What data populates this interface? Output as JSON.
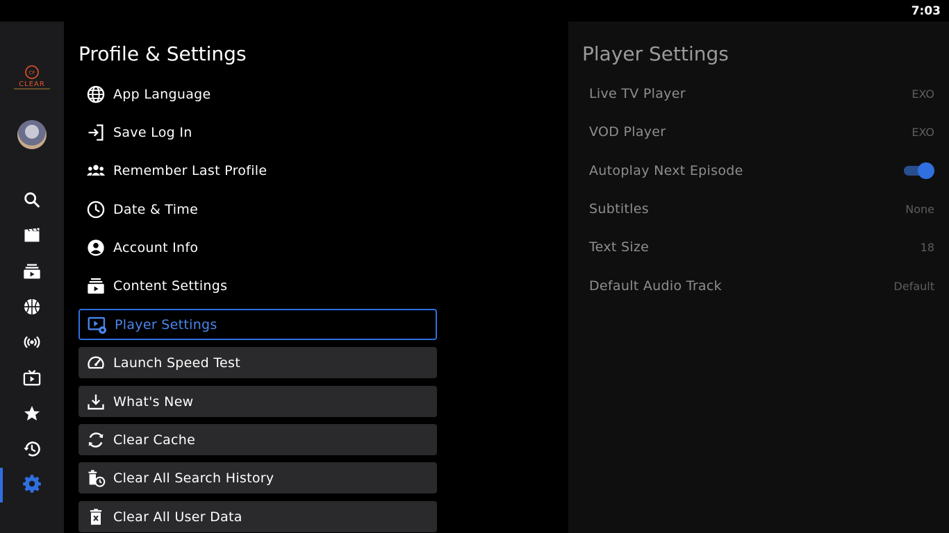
{
  "status": {
    "time": "7:03"
  },
  "nav": {
    "logo_text": "CLEAR",
    "items": [
      {
        "name": "search-icon"
      },
      {
        "name": "movies-icon"
      },
      {
        "name": "series-icon"
      },
      {
        "name": "sports-icon"
      },
      {
        "name": "broadcast-icon"
      },
      {
        "name": "live-tv-icon"
      },
      {
        "name": "favorites-icon"
      },
      {
        "name": "history-icon"
      },
      {
        "name": "settings-icon",
        "active": true
      }
    ],
    "accent_color": "#2f6fe0"
  },
  "left": {
    "title": "Profile & Settings",
    "items": [
      {
        "label": "App Language",
        "icon": "globe-icon"
      },
      {
        "label": "Save Log In",
        "icon": "login-icon"
      },
      {
        "label": "Remember Last Profile",
        "icon": "group-icon"
      },
      {
        "label": "Date & Time",
        "icon": "clock-icon"
      },
      {
        "label": "Account Info",
        "icon": "account-icon"
      },
      {
        "label": "Content Settings",
        "icon": "content-icon"
      },
      {
        "label": "Player Settings",
        "icon": "player-settings-icon",
        "selected": true
      },
      {
        "label": "Launch Speed Test",
        "icon": "speedometer-icon"
      },
      {
        "label": "What's New",
        "icon": "download-icon"
      },
      {
        "label": "Clear Cache",
        "icon": "refresh-icon"
      },
      {
        "label": "Clear All Search History",
        "icon": "delete-history-icon"
      },
      {
        "label": "Clear All User Data",
        "icon": "delete-data-icon"
      }
    ]
  },
  "right": {
    "title": "Player Settings",
    "settings": [
      {
        "label": "Live TV Player",
        "value": "EXO"
      },
      {
        "label": "VOD Player",
        "value": "EXO"
      },
      {
        "label": "Autoplay Next Episode",
        "toggle": true
      },
      {
        "label": "Subtitles",
        "value": "None"
      },
      {
        "label": "Text Size",
        "value": "18"
      },
      {
        "label": "Default Audio Track",
        "value": "Default"
      }
    ]
  }
}
